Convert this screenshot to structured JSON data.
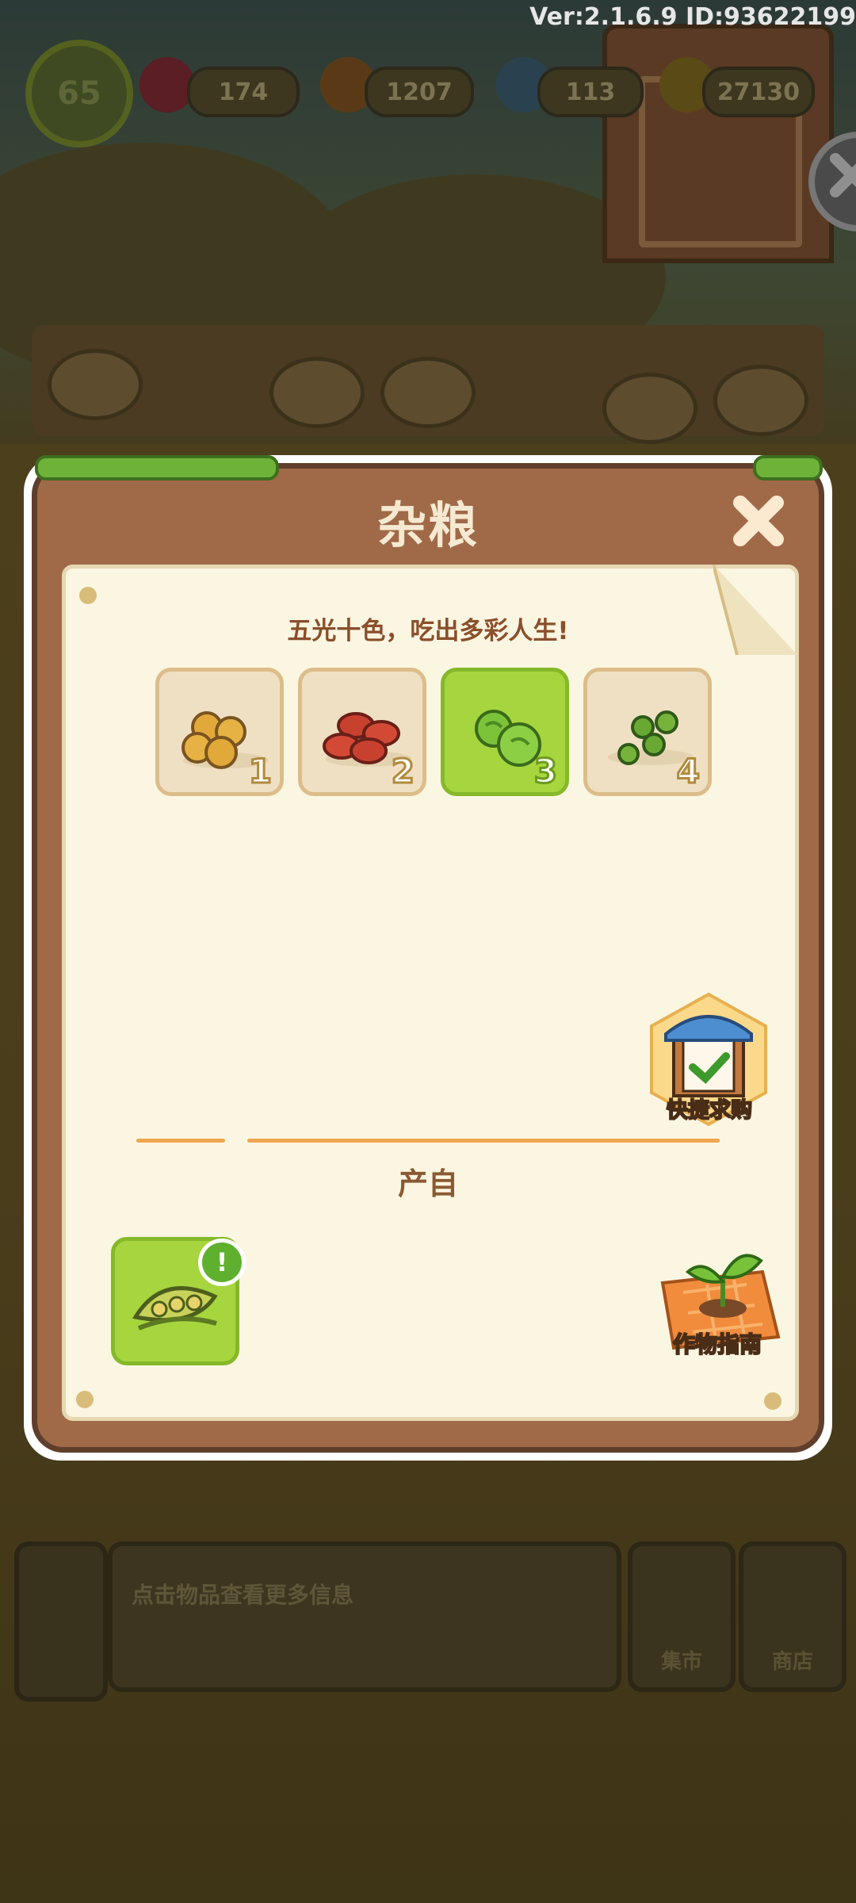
{
  "version_text": "Ver:2.1.6.9 ID:93622199",
  "hud": {
    "level": "65",
    "gems": "174",
    "carrots": "1207",
    "energy": "113",
    "coins": "27130"
  },
  "background": {
    "hint_text": "点击物品查看更多信息",
    "market_label": "集市",
    "shop_label": "商店"
  },
  "modal": {
    "title": "杂粮",
    "subtitle": "五光十色，吃出多彩人生!",
    "stages": [
      {
        "number": "1",
        "item": "soybeans",
        "selected": false
      },
      {
        "number": "2",
        "item": "red-beans",
        "selected": false
      },
      {
        "number": "3",
        "item": "green-peas",
        "selected": true
      },
      {
        "number": "4",
        "item": "edamame",
        "selected": false
      }
    ],
    "quick_buy_label": "快捷求购",
    "produce_title": "产自",
    "source_item": "pea-pod",
    "source_alert": "!",
    "guide_label": "作物指南"
  },
  "colors": {
    "board": "#a06a48",
    "paper": "#fbf6e2",
    "active_slot": "#a7d53e",
    "subtitle": "#8a4f2b"
  }
}
